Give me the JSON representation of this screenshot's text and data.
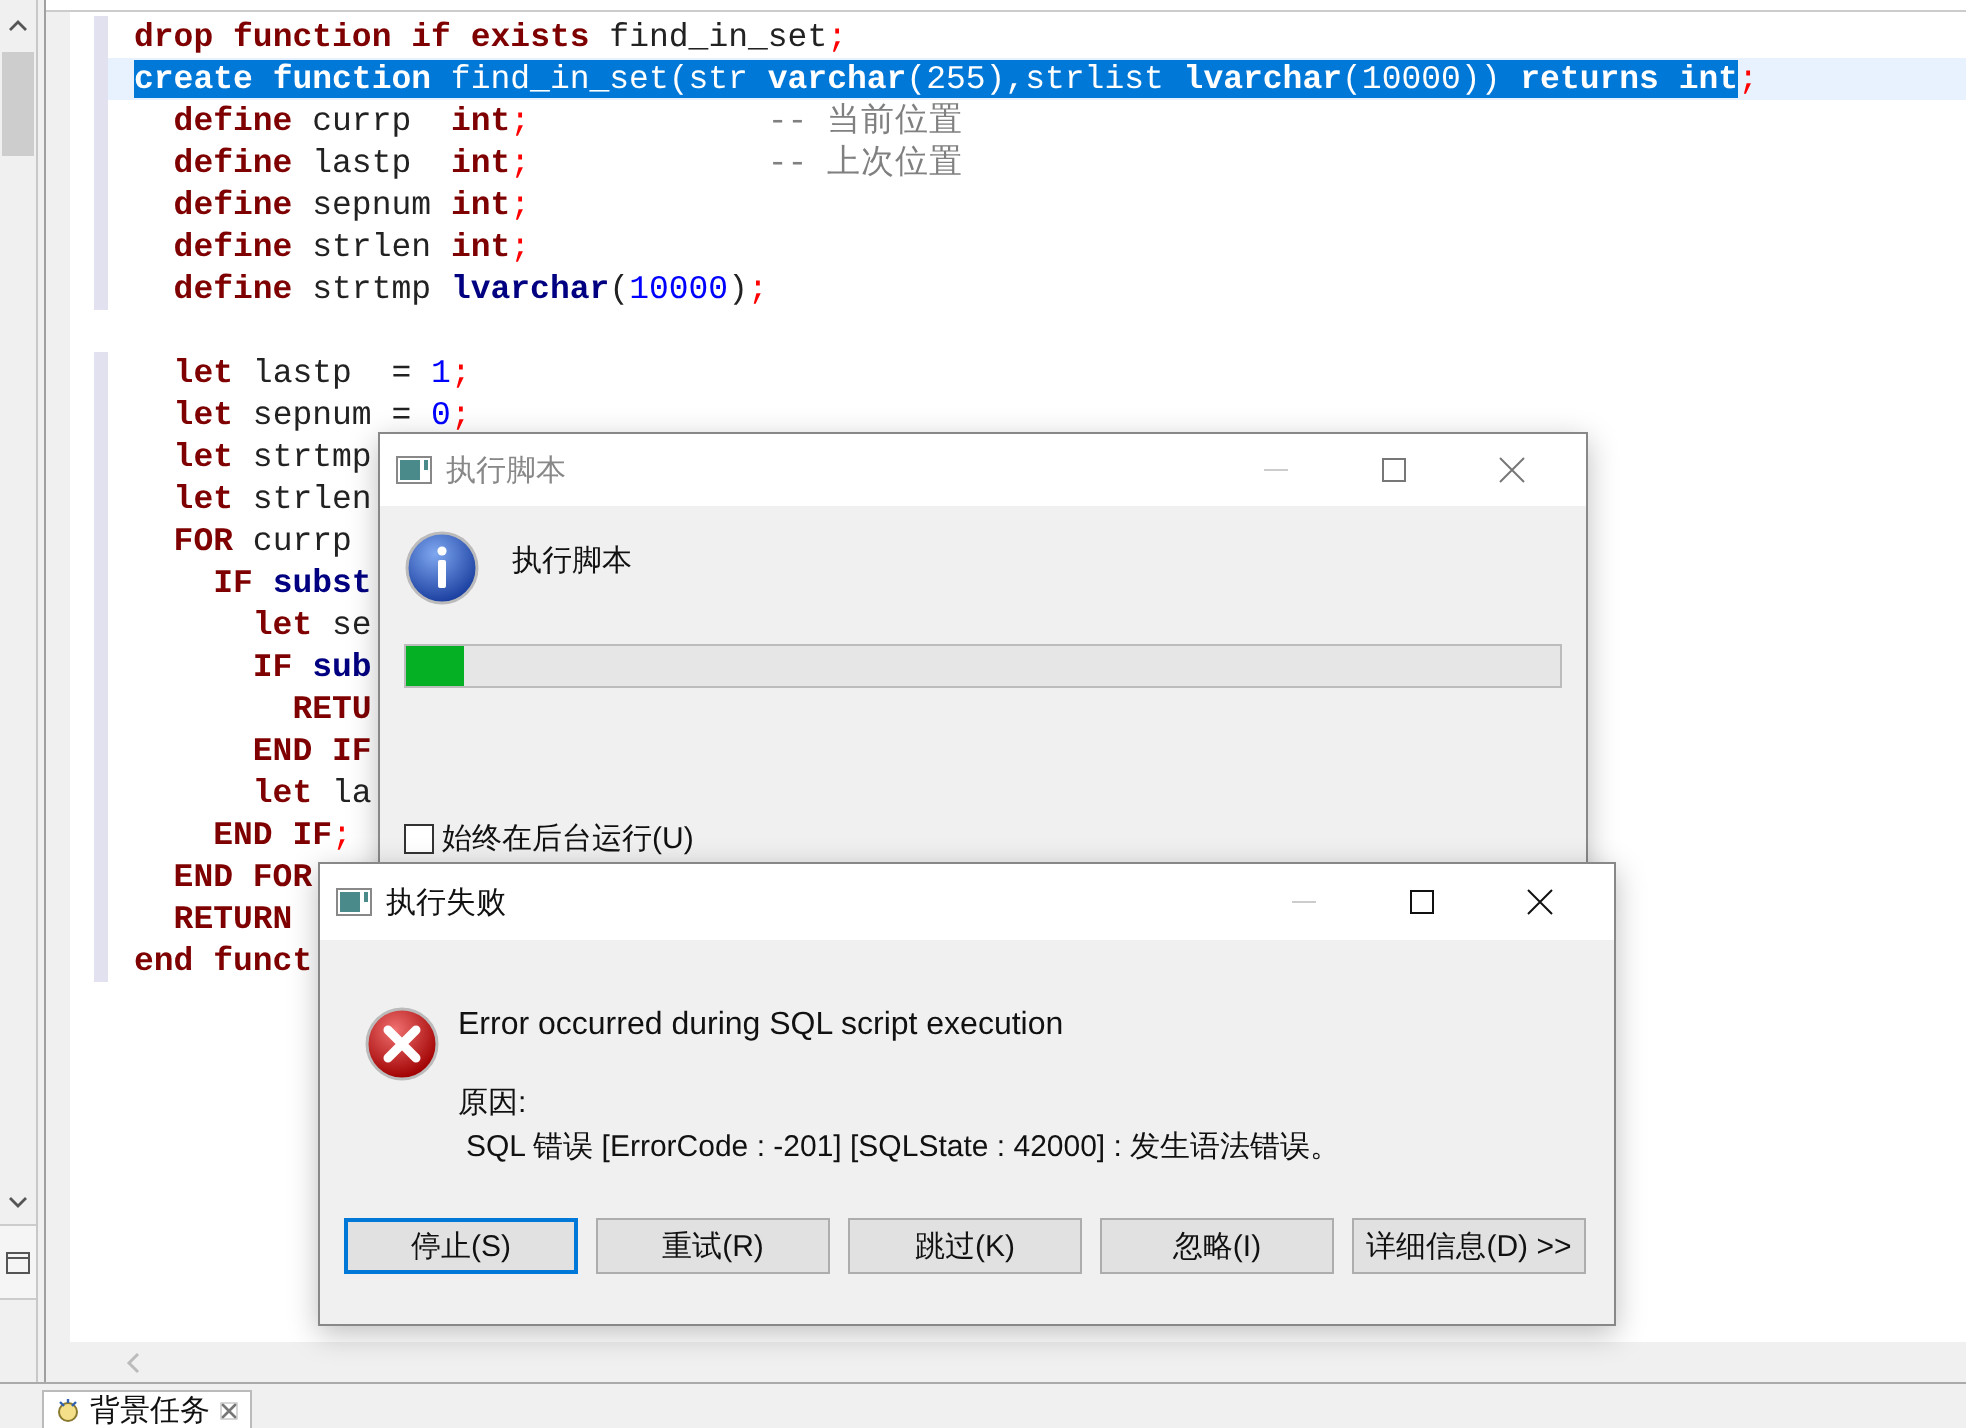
{
  "editor": {
    "lines": [
      {
        "selected": false,
        "tokens": [
          {
            "kind": "kw",
            "text": "drop "
          },
          {
            "kind": "kw",
            "text": "function "
          },
          {
            "kind": "kw",
            "text": "if "
          },
          {
            "kind": "kw",
            "text": "exists"
          },
          {
            "kind": "id",
            "text": " find_in_set"
          },
          {
            "kind": "op",
            "text": ";"
          }
        ]
      },
      {
        "selected": true,
        "tokens": [
          {
            "kind": "kw",
            "text": "create "
          },
          {
            "kind": "kw",
            "text": "function"
          },
          {
            "kind": "id",
            "text": " find_in_set(str "
          },
          {
            "kind": "type",
            "text": "varchar"
          },
          {
            "kind": "id",
            "text": "(255),strlist "
          },
          {
            "kind": "type",
            "text": "lvarchar"
          },
          {
            "kind": "id",
            "text": "(10000)) "
          },
          {
            "kind": "kw",
            "text": "returns "
          },
          {
            "kind": "kw",
            "text": "int"
          },
          {
            "kind": "op",
            "text": ";"
          }
        ]
      },
      {
        "selected": false,
        "tokens": [
          {
            "kind": "kw",
            "text": "  define"
          },
          {
            "kind": "id",
            "text": " currp  "
          },
          {
            "kind": "kw",
            "text": "int"
          },
          {
            "kind": "op",
            "text": ";"
          },
          {
            "kind": "comment",
            "text": "            -- 当前位置"
          }
        ]
      },
      {
        "selected": false,
        "tokens": [
          {
            "kind": "kw",
            "text": "  define"
          },
          {
            "kind": "id",
            "text": " lastp  "
          },
          {
            "kind": "kw",
            "text": "int"
          },
          {
            "kind": "op",
            "text": ";"
          },
          {
            "kind": "comment",
            "text": "            -- 上次位置"
          }
        ]
      },
      {
        "selected": false,
        "tokens": [
          {
            "kind": "kw",
            "text": "  define"
          },
          {
            "kind": "id",
            "text": " sepnum "
          },
          {
            "kind": "kw",
            "text": "int"
          },
          {
            "kind": "op",
            "text": ";"
          }
        ]
      },
      {
        "selected": false,
        "tokens": [
          {
            "kind": "kw",
            "text": "  define"
          },
          {
            "kind": "id",
            "text": " strlen "
          },
          {
            "kind": "kw",
            "text": "int"
          },
          {
            "kind": "op",
            "text": ";"
          }
        ]
      },
      {
        "selected": false,
        "tokens": [
          {
            "kind": "kw",
            "text": "  define"
          },
          {
            "kind": "id",
            "text": " strtmp "
          },
          {
            "kind": "type",
            "text": "lvarchar"
          },
          {
            "kind": "id",
            "text": "("
          },
          {
            "kind": "num",
            "text": "10000"
          },
          {
            "kind": "id",
            "text": ")"
          },
          {
            "kind": "op",
            "text": ";"
          }
        ]
      },
      {
        "selected": false
      },
      {
        "selected": false,
        "tokens": [
          {
            "kind": "kw",
            "text": "  let"
          },
          {
            "kind": "id",
            "text": " lastp  = "
          },
          {
            "kind": "num",
            "text": "1"
          },
          {
            "kind": "op",
            "text": ";"
          }
        ]
      },
      {
        "selected": false,
        "tokens": [
          {
            "kind": "kw",
            "text": "  let"
          },
          {
            "kind": "id",
            "text": " sepnum = "
          },
          {
            "kind": "num",
            "text": "0"
          },
          {
            "kind": "op",
            "text": ";"
          }
        ]
      },
      {
        "selected": false,
        "tokens": [
          {
            "kind": "kw",
            "text": "  let"
          },
          {
            "kind": "id",
            "text": " strtmp"
          }
        ]
      },
      {
        "selected": false,
        "tokens": [
          {
            "kind": "kw",
            "text": "  let"
          },
          {
            "kind": "id",
            "text": " strlen"
          }
        ]
      },
      {
        "selected": false,
        "tokens": [
          {
            "kind": "kw",
            "text": "  FOR"
          },
          {
            "kind": "id",
            "text": " currp"
          }
        ]
      },
      {
        "selected": false,
        "tokens": [
          {
            "kind": "kw",
            "text": "    IF "
          },
          {
            "kind": "type",
            "text": "subst"
          }
        ]
      },
      {
        "selected": false,
        "tokens": [
          {
            "kind": "kw",
            "text": "      let"
          },
          {
            "kind": "id",
            "text": " se"
          }
        ]
      },
      {
        "selected": false,
        "tokens": [
          {
            "kind": "kw",
            "text": "      IF "
          },
          {
            "kind": "type",
            "text": "sub"
          }
        ]
      },
      {
        "selected": false,
        "tokens": [
          {
            "kind": "kw",
            "text": "        RETU"
          }
        ]
      },
      {
        "selected": false,
        "tokens": [
          {
            "kind": "kw",
            "text": "      END IF"
          }
        ]
      },
      {
        "selected": false,
        "tokens": [
          {
            "kind": "kw",
            "text": "      let"
          },
          {
            "kind": "id",
            "text": " la"
          }
        ]
      },
      {
        "selected": false,
        "tokens": [
          {
            "kind": "kw",
            "text": "    END IF"
          },
          {
            "kind": "op",
            "text": ";"
          }
        ]
      },
      {
        "selected": false,
        "tokens": [
          {
            "kind": "kw",
            "text": "  END FOR"
          }
        ]
      },
      {
        "selected": false,
        "tokens": [
          {
            "kind": "kw",
            "text": "  RETURN"
          }
        ]
      },
      {
        "selected": false,
        "tokens": [
          {
            "kind": "kw",
            "text": "end funct"
          }
        ]
      }
    ]
  },
  "progress_dialog": {
    "title": "执行脚本",
    "active": false,
    "message": "执行脚本",
    "progress": {
      "level": 0.05
    },
    "checkbox": {
      "label": "始终在后台运行(U)",
      "checked": false
    }
  },
  "error_dialog": {
    "title": "执行失败",
    "active": true,
    "heading": "Error occurred during SQL script execution",
    "reason_label": "原因:",
    "reason": "SQL 错误 [ErrorCode : -201]  [SQLState : 42000] : 发生语法错误。",
    "buttons": [
      {
        "label": "停止(S)",
        "focused": true
      },
      {
        "label": "重试(R)",
        "focused": false
      },
      {
        "label": "跳过(K)",
        "focused": false
      },
      {
        "label": "忽略(I)",
        "focused": false
      },
      {
        "label": "详细信息(D) >>",
        "focused": false
      }
    ]
  },
  "bottom_tab": {
    "label": "背景任务"
  }
}
